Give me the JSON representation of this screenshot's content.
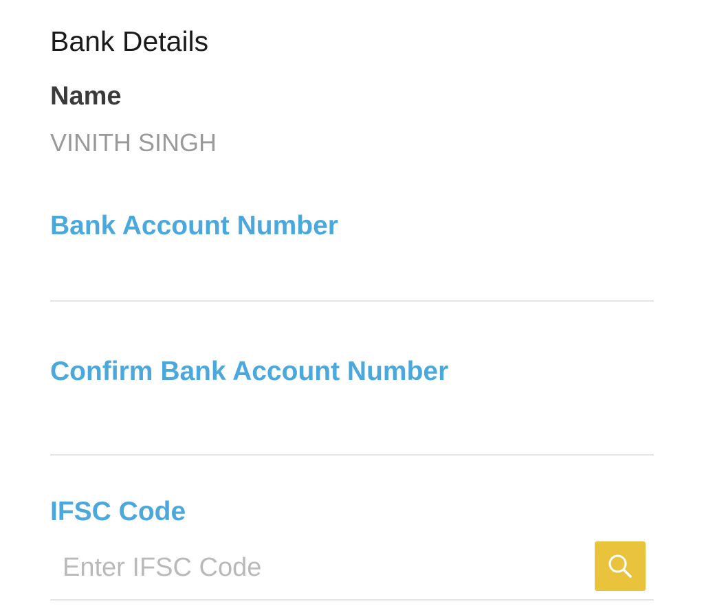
{
  "section": {
    "title": "Bank Details"
  },
  "name": {
    "label": "Name",
    "value": "VINITH SINGH"
  },
  "fields": {
    "account_number": {
      "label": "Bank Account Number",
      "value": ""
    },
    "confirm_account_number": {
      "label": "Confirm Bank Account Number",
      "value": ""
    },
    "ifsc": {
      "label": "IFSC Code",
      "value": "",
      "placeholder": "Enter IFSC Code"
    }
  },
  "icons": {
    "search": "search-icon"
  },
  "colors": {
    "label_blue": "#4aa8dd",
    "search_button": "#e9c33c",
    "divider": "#e4e4e4",
    "name_value": "#9a9a9a"
  }
}
